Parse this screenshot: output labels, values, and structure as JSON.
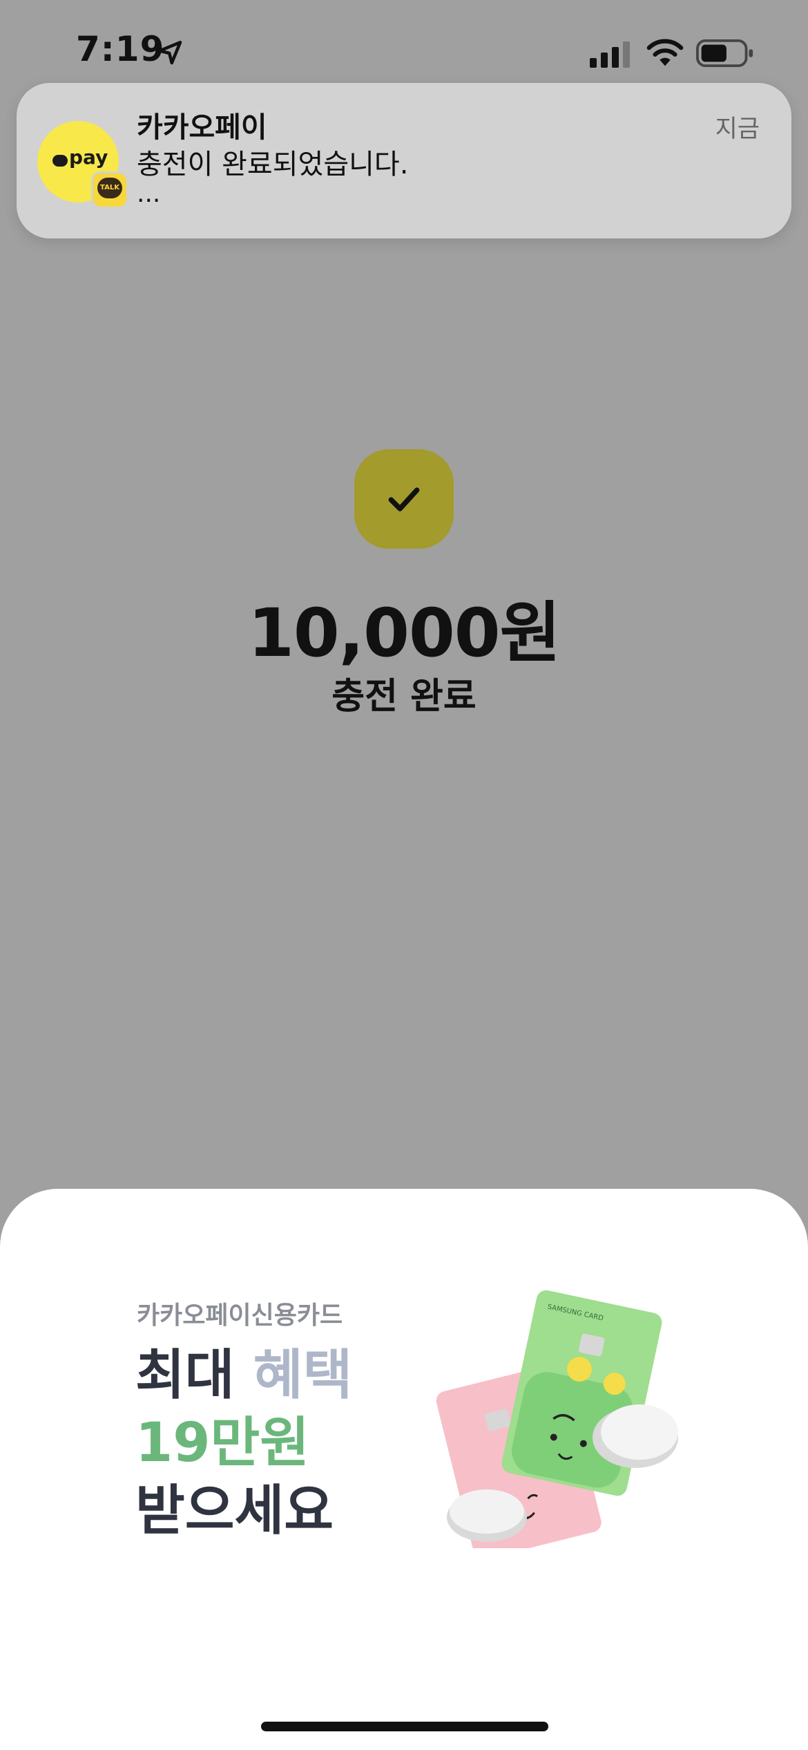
{
  "status_bar": {
    "time": "7:19"
  },
  "notification": {
    "app_name": "카카오페이",
    "message": "충전이 완료되었습니다.",
    "more": "...",
    "timestamp": "지금",
    "icon_text": "pay",
    "badge_text": "TALK",
    "icon_color": "#f8e84a"
  },
  "result": {
    "amount": "10,000원",
    "label": "충전 완료",
    "check_badge_color": "#a39b2c"
  },
  "promo": {
    "subtitle": "카카오페이신용카드",
    "line1_dark": "최대 ",
    "line1_highlight": "혜택",
    "line2": "19만원",
    "line3": "받으세요",
    "accent_green": "#6bb77b",
    "card_brand_text": "SAMSUNG CARD"
  }
}
